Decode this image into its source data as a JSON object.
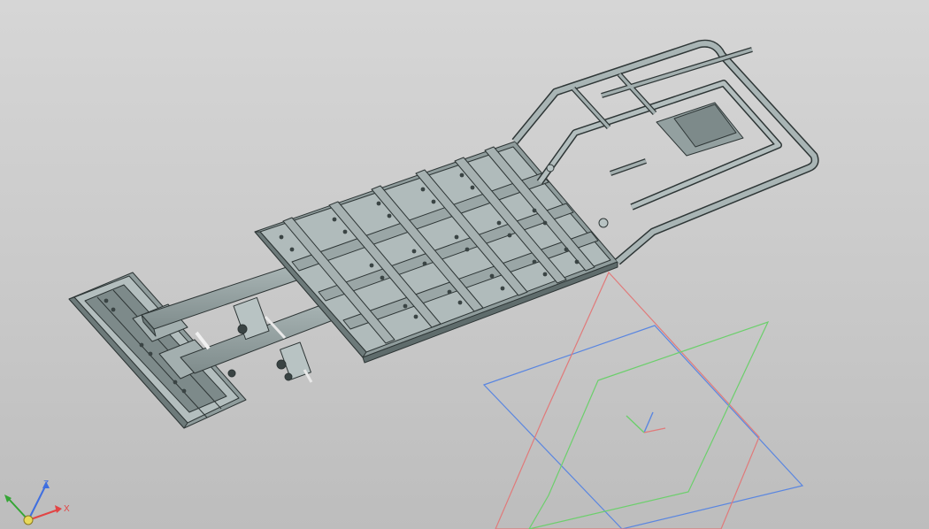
{
  "viewport": {
    "title": "",
    "background_top": "#d6d6d6",
    "background_bottom": "#bdbdbd"
  },
  "model": {
    "name": "trailer-chassis-frame",
    "fill_color": "#8f9c9c",
    "edge_color": "#2e3636"
  },
  "planes": {
    "xy_color": "#5a86e0",
    "zx_color": "#e07a7a",
    "zy_color": "#6ccf6c"
  },
  "triad": {
    "x_label": "X",
    "y_label": "Y",
    "z_label": "Z",
    "x_color": "#e24545",
    "y_color": "#35a535",
    "z_color": "#3f6fe0"
  }
}
